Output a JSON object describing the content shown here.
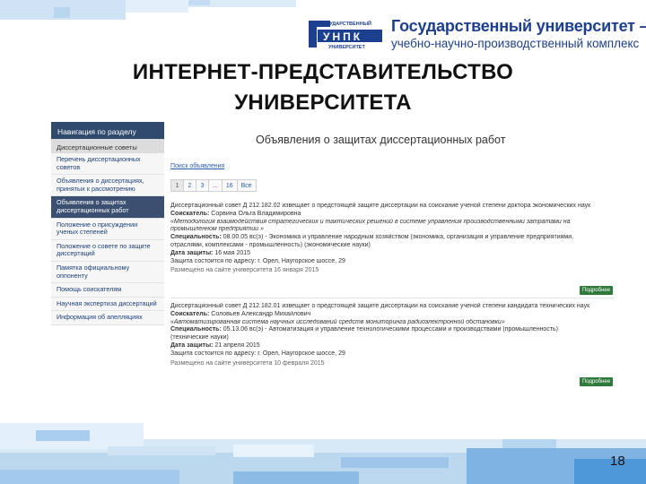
{
  "logo": {
    "mark_top": "ГОСУДАРСТВЕННЫЙ",
    "mark_mid": "УНПК",
    "mark_bottom": "УНИВЕРСИТЕТ",
    "title": "Государственный университет –",
    "subtitle": "учебно-научно-производственный комплекс",
    "color": "#1d3f8f"
  },
  "headline": {
    "line1": "ИНТЕРНЕТ-ПРЕДСТАВИТЕЛЬСТВО",
    "line2": "УНИВЕРСИТЕТА"
  },
  "sidebar": {
    "header": "Навигация по разделу",
    "section": "Диссертационные советы",
    "items": [
      {
        "label": "Перечень диссертационных советов",
        "active": false
      },
      {
        "label": "Объявления о диссертациях, принятых к рассмотрению",
        "active": false
      },
      {
        "label": "Объявления о защитах диссертационных работ",
        "active": true
      },
      {
        "label": "Положение о присуждении ученых степеней",
        "active": false
      },
      {
        "label": "Положение о совете по защите диссертаций",
        "active": false
      },
      {
        "label": "Памятка официальному оппоненту",
        "active": false
      },
      {
        "label": "Помощь соискателям",
        "active": false
      },
      {
        "label": "Научная экспертиза диссертаций",
        "active": false
      },
      {
        "label": "Информация об апелляциях",
        "active": false
      }
    ]
  },
  "main": {
    "title": "Объявления о защитах диссертационных работ",
    "search_link": "Поиск объявления",
    "pager": [
      "1",
      "2",
      "3",
      "...",
      "16",
      "Все"
    ],
    "ads": [
      {
        "line1": "Диссертационный совет Д 212.182.02 извещает о предстоящей защите диссертации на соискание ученой степени доктора экономических наук",
        "applicant_label": "Соискатель:",
        "applicant": "Сорвина Ольга Владимировна",
        "topic_1": "«Методология взаимодействия стратегических и тактических решений в системе управления производственными затратами на",
        "topic_2": "промышленном предприятии »",
        "spec_label": "Специальность:",
        "spec_1": "08.00.05 вс(э) - Экономика и управление народным хозяйством (экономика, организация и управление предприятиями,",
        "spec_2": "отраслями, комплексами - промышленность) (экономические науки)",
        "date_label": "Дата защиты:",
        "date": "16 мая 2015",
        "address": "Защита состоится по адресу: г. Орел, Наугорское шоссе, 29",
        "posted": "Размещено на сайте университета 16 января 2015",
        "more": "Подробнее"
      },
      {
        "line1": "Диссертационный совет Д 212.182.01 извещает о предстоящей защите диссертации на соискание ученой степени кандидата технических наук",
        "applicant_label": "Соискатель:",
        "applicant": "Соловьев Александр Михайлович",
        "topic_1": "«Автоматизированная система научных исследований средств мониторинга радиоэлектронной обстановки»",
        "spec_label": "Специальность:",
        "spec_1": "05.13.06 вс(э) - Автоматизация и управление технологическими процессами и производствами (промышленность)",
        "spec_2": "(технические науки)",
        "date_label": "Дата защиты:",
        "date": "21 апреля 2015",
        "address": "Защита состоится по адресу: г. Орел, Наугорское шоссе, 29",
        "posted": "Размещено на сайте университета 10 февраля 2015",
        "more": "Подробнее"
      }
    ]
  },
  "slide_number": "18",
  "colors": {
    "nav_header": "#2f4a6d",
    "button_green": "#2f7a3a",
    "accent_blue": "#2a8fd6"
  }
}
